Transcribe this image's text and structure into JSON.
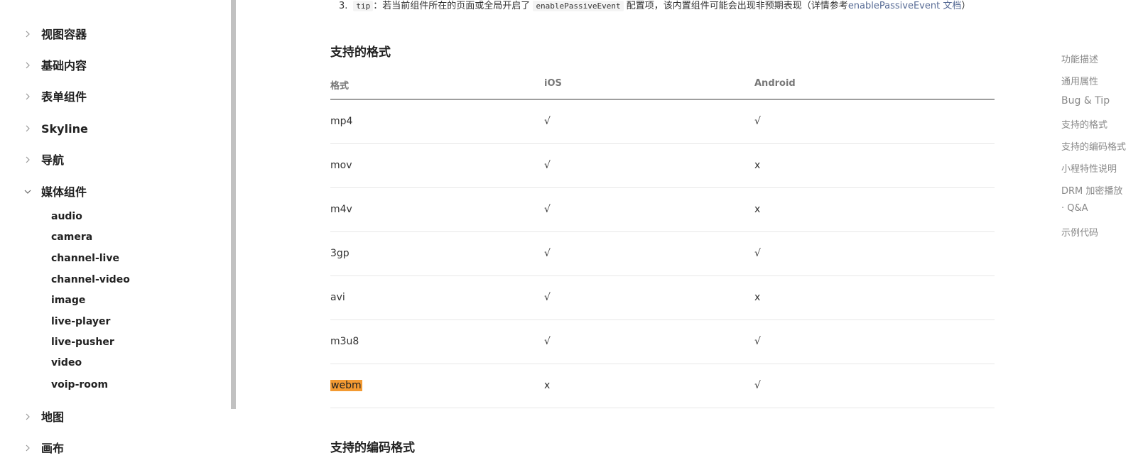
{
  "sidebar": {
    "groups": [
      {
        "label": "视图容器"
      },
      {
        "label": "基础内容"
      },
      {
        "label": "表单组件"
      },
      {
        "label": "Skyline"
      },
      {
        "label": "导航"
      },
      {
        "label": "媒体组件"
      },
      {
        "label": "地图"
      },
      {
        "label": "画布"
      }
    ],
    "media_items": [
      "audio",
      "camera",
      "channel-live",
      "channel-video",
      "image",
      "live-player",
      "live-pusher",
      "video",
      "voip-room"
    ]
  },
  "tip": {
    "number": "3.",
    "code1": "tip",
    "text1": "：若当前组件所在的页面或全局开启了",
    "code2": "enablePassiveEvent",
    "text2": "配置项，该内置组件可能会出现非预期表现（详情参考",
    "link": "enablePassiveEvent 文档",
    "text3": "）"
  },
  "section_formats": {
    "title": "支持的格式",
    "headers": [
      "格式",
      "iOS",
      "Android"
    ],
    "rows": [
      [
        "mp4",
        "√",
        "√"
      ],
      [
        "mov",
        "√",
        "x"
      ],
      [
        "m4v",
        "√",
        "x"
      ],
      [
        "3gp",
        "√",
        "√"
      ],
      [
        "avi",
        "√",
        "x"
      ],
      [
        "m3u8",
        "√",
        "√"
      ],
      [
        "webm",
        "x",
        "√"
      ]
    ]
  },
  "section_codecs": {
    "title": "支持的编码格式"
  },
  "toc": {
    "items": [
      "功能描述",
      "通用属性",
      "Bug & Tip",
      "支持的格式",
      "支持的编码格式",
      "小程特性说明",
      "DRM 加密播放",
      "· Q&A",
      "示例代码"
    ]
  },
  "colors": {
    "highlight": "#f39a32",
    "link": "#576b95",
    "scrollbar": "#c1c1c1"
  }
}
